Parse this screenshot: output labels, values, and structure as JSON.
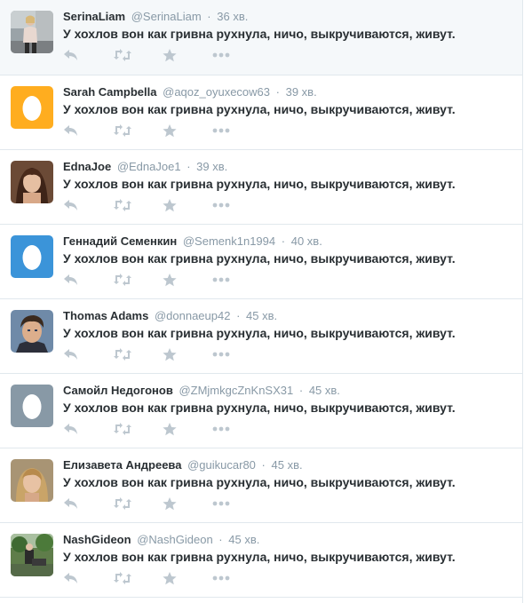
{
  "colors": {
    "icon": "#bdc7cf",
    "handle": "#8899a6",
    "egg_orange": "#ffad1f",
    "egg_blue": "#3b94d9",
    "egg_gray": "#8899a6"
  },
  "actions": [
    "reply-icon",
    "retweet-icon",
    "favorite-icon",
    "more-icon"
  ],
  "tweets": [
    {
      "name": "SerinaLiam",
      "handle": "@SerinaLiam",
      "time": "36 хв.",
      "text": "У хохлов вон как гривна рухнула, ничо, выкручиваются, живут.",
      "avatar": "photo-woman-standing"
    },
    {
      "name": "Sarah Campbella",
      "handle": "@aqoz_oyuxecow63",
      "time": "39 хв.",
      "text": "У хохлов вон как гривна рухнула, ничо, выкручиваются, живут.",
      "avatar": "default-egg-orange"
    },
    {
      "name": "EdnaJoe",
      "handle": "@EdnaJoe1",
      "time": "39 хв.",
      "text": "У хохлов вон как гривна рухнула, ничо, выкручиваются, живут.",
      "avatar": "photo-woman-portrait"
    },
    {
      "name": "Геннадий Семенкин",
      "handle": "@Semenk1n1994",
      "time": "40 хв.",
      "text": "У хохлов вон как гривна рухнула, ничо, выкручиваются, живут.",
      "avatar": "default-egg-blue"
    },
    {
      "name": "Thomas Adams",
      "handle": "@donnaeup42",
      "time": "45 хв.",
      "text": "У хохлов вон как гривна рухнула, ничо, выкручиваются, живут.",
      "avatar": "photo-man-portrait"
    },
    {
      "name": "Самойл Недогонов",
      "handle": "@ZMjmkgcZnKnSX31",
      "time": "45 хв.",
      "text": "У хохлов вон как гривна рухнула, ничо, выкручиваются, живут.",
      "avatar": "default-egg-gray"
    },
    {
      "name": "Елизавета Андреева",
      "handle": "@guikucar80",
      "time": "45 хв.",
      "text": "У хохлов вон как гривна рухнула, ничо, выкручиваются, живут.",
      "avatar": "photo-woman-blonde"
    },
    {
      "name": "NashGideon",
      "handle": "@NashGideon",
      "time": "45 хв.",
      "text": "У хохлов вон как гривна рухнула, ничо, выкручиваются, живут.",
      "avatar": "photo-outdoor"
    }
  ]
}
